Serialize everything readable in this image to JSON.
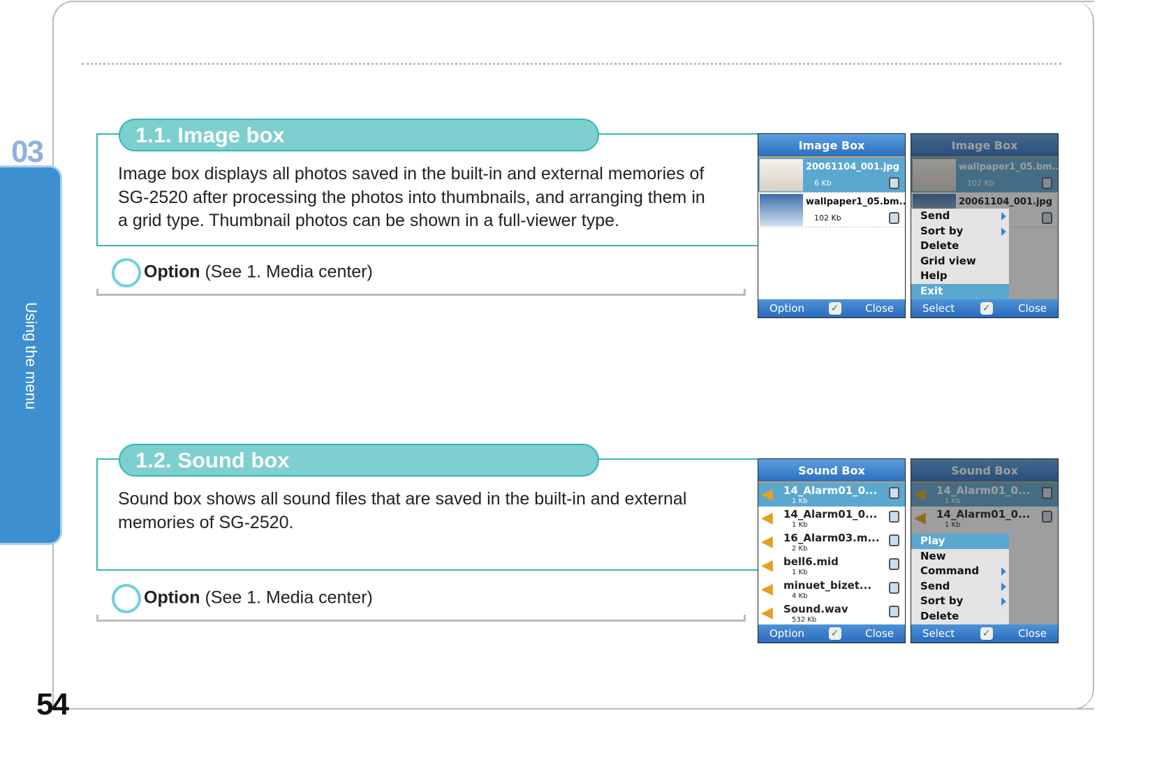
{
  "chapter": {
    "number": "03",
    "tab_label": "Using the menu",
    "page_number": "54"
  },
  "sections": [
    {
      "title": "1.1. Image box",
      "description": "Image box displays all photos saved in the built-in and external memories of SG-2520 after processing the photos into thumbnails, and arranging them in a grid type. Thumbnail photos can be shown in a full-viewer type.",
      "option_label": "Option",
      "option_ref": "(See 1. Media center)"
    },
    {
      "title": "1.2. Sound box",
      "description": "Sound box shows all sound files that are saved in the built-in and external memories of SG-2520.",
      "option_label": "Option",
      "option_ref": "(See 1. Media center)"
    }
  ],
  "image_screens": [
    {
      "header": "Image Box",
      "items": [
        {
          "name": "20061104_001.jpg",
          "size": "6 Kb"
        },
        {
          "name": "wallpaper1_05.bm...",
          "size": "102 Kb"
        }
      ],
      "left_soft": "Option",
      "right_soft": "Close"
    },
    {
      "header": "Image Box",
      "items": [
        {
          "name": "wallpaper1_05.bm...",
          "size": "102 Kb"
        },
        {
          "name": "20061104_001.jpg",
          "size": ""
        }
      ],
      "menu": [
        "Send",
        "Sort by",
        "Delete",
        "Grid view",
        "Help",
        "Exit"
      ],
      "left_soft": "Select",
      "right_soft": "Close"
    }
  ],
  "sound_screens": [
    {
      "header": "Sound Box",
      "items": [
        {
          "name": "14_Alarm01_0...",
          "size": "1 Kb"
        },
        {
          "name": "14_Alarm01_0...",
          "size": "1 Kb"
        },
        {
          "name": "16_Alarm03.m...",
          "size": "2 Kb"
        },
        {
          "name": "bell6.mid",
          "size": "1 Kb"
        },
        {
          "name": "minuet_bizet...",
          "size": "4 Kb"
        },
        {
          "name": "Sound.wav",
          "size": "532 Kb"
        }
      ],
      "left_soft": "Option",
      "right_soft": "Close"
    },
    {
      "header": "Sound Box",
      "items": [
        {
          "name": "14_Alarm01_0...",
          "size": "1 Kb"
        },
        {
          "name": "14_Alarm01_0...",
          "size": "1 Kb"
        }
      ],
      "menu": [
        "Play",
        "New",
        "Command",
        "Send",
        "Sort by",
        "Delete"
      ],
      "left_soft": "Select",
      "right_soft": "Close"
    }
  ],
  "colors": {
    "accent_teal": "#33b8b8",
    "pill": "#7ecfcf",
    "tab_blue": "#3d8fd0",
    "selection": "#5aa7d0"
  }
}
